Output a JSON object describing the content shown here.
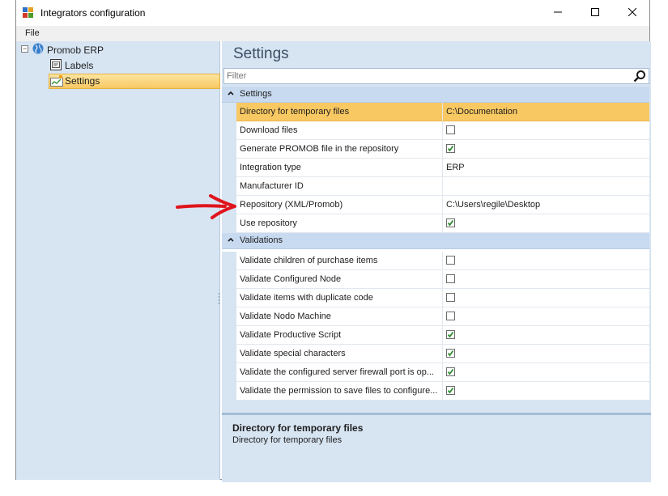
{
  "window": {
    "title": "Integrators configuration",
    "menu": {
      "file": "File"
    }
  },
  "tree": {
    "root": "Promob ERP",
    "items": [
      {
        "label": "Labels",
        "icon": "labels-icon"
      },
      {
        "label": "Settings",
        "icon": "settings-chart-icon",
        "selected": true
      }
    ]
  },
  "panel": {
    "title": "Settings",
    "filter_placeholder": "Filter"
  },
  "categories": [
    {
      "name": "Settings",
      "properties": [
        {
          "name": "Directory for temporary files",
          "value": "C:\\Documentation",
          "type": "text",
          "selected": true
        },
        {
          "name": "Download files",
          "type": "checkbox",
          "checked": false
        },
        {
          "name": "Generate PROMOB file in the repository",
          "type": "checkbox",
          "checked": true
        },
        {
          "name": "Integration type",
          "value": "ERP",
          "type": "text"
        },
        {
          "name": "Manufacturer ID",
          "value": "",
          "type": "text"
        },
        {
          "name": "Repository (XML/Promob)",
          "value": "C:\\Users\\regile\\Desktop",
          "type": "text"
        },
        {
          "name": "Use repository",
          "type": "checkbox",
          "checked": true
        }
      ]
    },
    {
      "name": "Validations",
      "properties": [
        {
          "name": "Validate children of purchase items",
          "type": "checkbox",
          "checked": false
        },
        {
          "name": "Validate Configured Node",
          "type": "checkbox",
          "checked": false
        },
        {
          "name": "Validate items with duplicate code",
          "type": "checkbox",
          "checked": false
        },
        {
          "name": "Validate Nodo Machine",
          "type": "checkbox",
          "checked": false
        },
        {
          "name": "Validate Productive Script",
          "type": "checkbox",
          "checked": true
        },
        {
          "name": "Validate special characters",
          "type": "checkbox",
          "checked": true
        },
        {
          "name": "Validate the configured server firewall port is op...",
          "type": "checkbox",
          "checked": true
        },
        {
          "name": "Validate the permission to save files to configure...",
          "type": "checkbox",
          "checked": true
        }
      ]
    }
  ],
  "description": {
    "title": "Directory for temporary files",
    "text": "Directory for temporary files"
  },
  "colors": {
    "pane_bg": "#d7e4f2",
    "category_bg": "#c8daf0",
    "selection": "#f8c862",
    "check_green": "#2e8b2e",
    "annotation_arrow": "#e0141b"
  }
}
